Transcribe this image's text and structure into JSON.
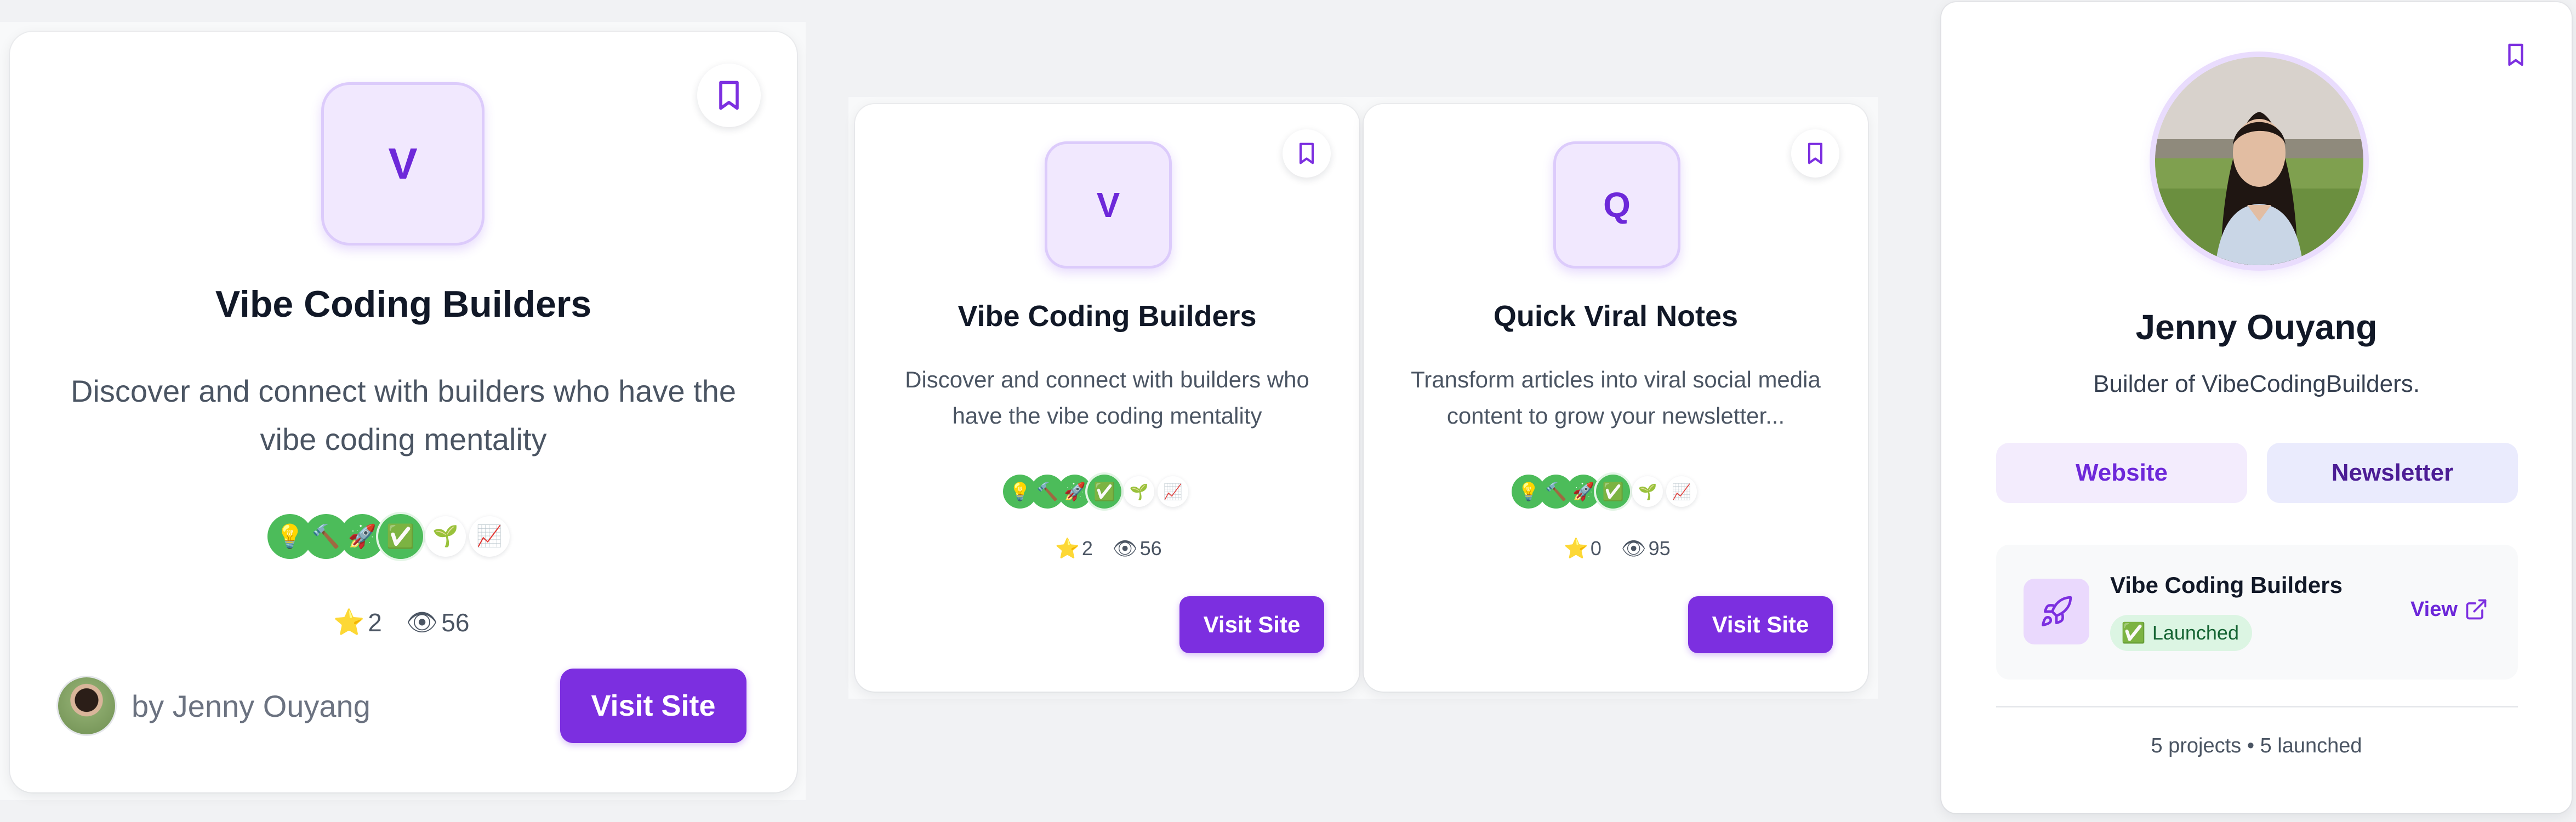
{
  "colors": {
    "accent": "#7c2fe0",
    "accent_light": "#f1e8fe",
    "badge_green": "#4cbc5a",
    "page_bg": "#f1f2f4",
    "card_bg": "#ffffff"
  },
  "large_card": {
    "logo_letter": "V",
    "title": "Vibe Coding Builders",
    "description": "Discover and connect with builders who have the vibe coding mentality",
    "badges": [
      {
        "icon": "lightbulb-icon",
        "glyph": "💡",
        "style": "green"
      },
      {
        "icon": "hammer-icon",
        "glyph": "🔨",
        "style": "green"
      },
      {
        "icon": "rocket-icon",
        "glyph": "🚀",
        "style": "green"
      },
      {
        "icon": "check-icon",
        "glyph": "✅",
        "style": "green-ring"
      },
      {
        "icon": "seedling-icon",
        "glyph": "🌱",
        "style": "white"
      },
      {
        "icon": "chart-icon",
        "glyph": "📈",
        "style": "white"
      }
    ],
    "stars": "2",
    "views": "56",
    "author": "by Jenny Ouyang",
    "visit_label": "Visit Site",
    "bookmark_icon": "bookmark-icon"
  },
  "medium_cards": [
    {
      "logo_letter": "V",
      "title": "Vibe Coding Builders",
      "description": "Discover and connect with builders who have the vibe coding mentality",
      "stars": "2",
      "views": "56",
      "visit_label": "Visit Site"
    },
    {
      "logo_letter": "Q",
      "title": "Quick Viral Notes",
      "description": "Transform articles into viral social media content to grow your newsletter...",
      "stars": "0",
      "views": "95",
      "visit_label": "Visit Site"
    }
  ],
  "profile_card": {
    "name": "Jenny Ouyang",
    "bio": "Builder of VibeCodingBuilders.",
    "website_label": "Website",
    "newsletter_label": "Newsletter",
    "project": {
      "name": "Vibe Coding Builders",
      "status": "Launched",
      "status_icon": "check-icon",
      "view_label": "View",
      "icon": "rocket-icon"
    },
    "summary": "5 projects • 5 launched"
  }
}
